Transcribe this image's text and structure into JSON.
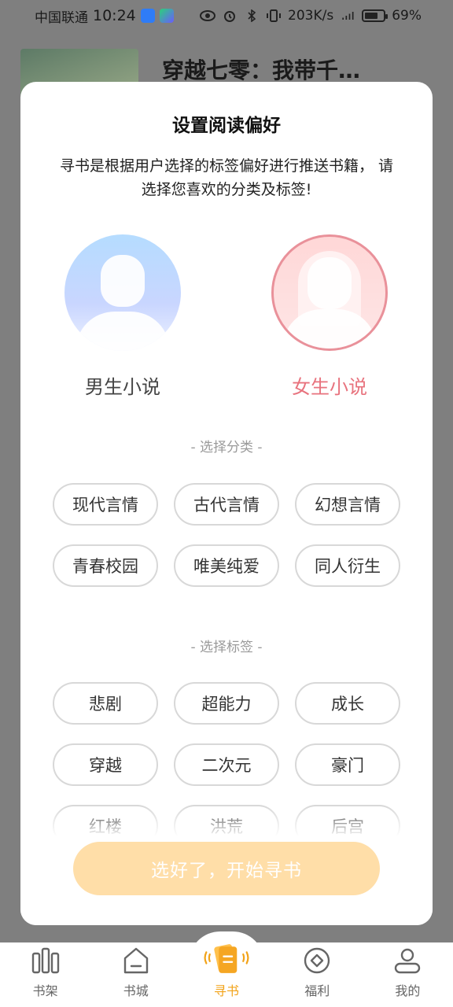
{
  "status_bar": {
    "carrier": "中国联通",
    "time": "10:24",
    "network_speed": "203K/s",
    "battery_percent": "69%"
  },
  "background": {
    "book_title": "穿越七零：我带千…"
  },
  "modal": {
    "title": "设置阅读偏好",
    "description": "寻书是根据用户选择的标签偏好进行推送书籍， 请选择您喜欢的分类及标签!",
    "genders": [
      {
        "label": "男生小说",
        "selected": false
      },
      {
        "label": "女生小说",
        "selected": true
      }
    ],
    "category_title": "- 选择分类 -",
    "categories": [
      "现代言情",
      "古代言情",
      "幻想言情",
      "青春校园",
      "唯美纯爱",
      "同人衍生"
    ],
    "tag_title": "- 选择标签 -",
    "tags": [
      "悲剧",
      "超能力",
      "成长",
      "穿越",
      "二次元",
      "豪门",
      "红楼",
      "洪荒",
      "后宫"
    ],
    "confirm_label": "选好了，开始寻书"
  },
  "nav": {
    "items": [
      {
        "label": "书架",
        "icon": "bookshelf-icon",
        "active": false
      },
      {
        "label": "书城",
        "icon": "bookstore-icon",
        "active": false
      },
      {
        "label": "寻书",
        "icon": "find-book-icon",
        "active": true
      },
      {
        "label": "福利",
        "icon": "welfare-icon",
        "active": false
      },
      {
        "label": "我的",
        "icon": "profile-icon",
        "active": false
      }
    ]
  },
  "colors": {
    "accent": "#f2a319",
    "female_accent": "#e8737e",
    "button_bg": "#ffdea8"
  }
}
